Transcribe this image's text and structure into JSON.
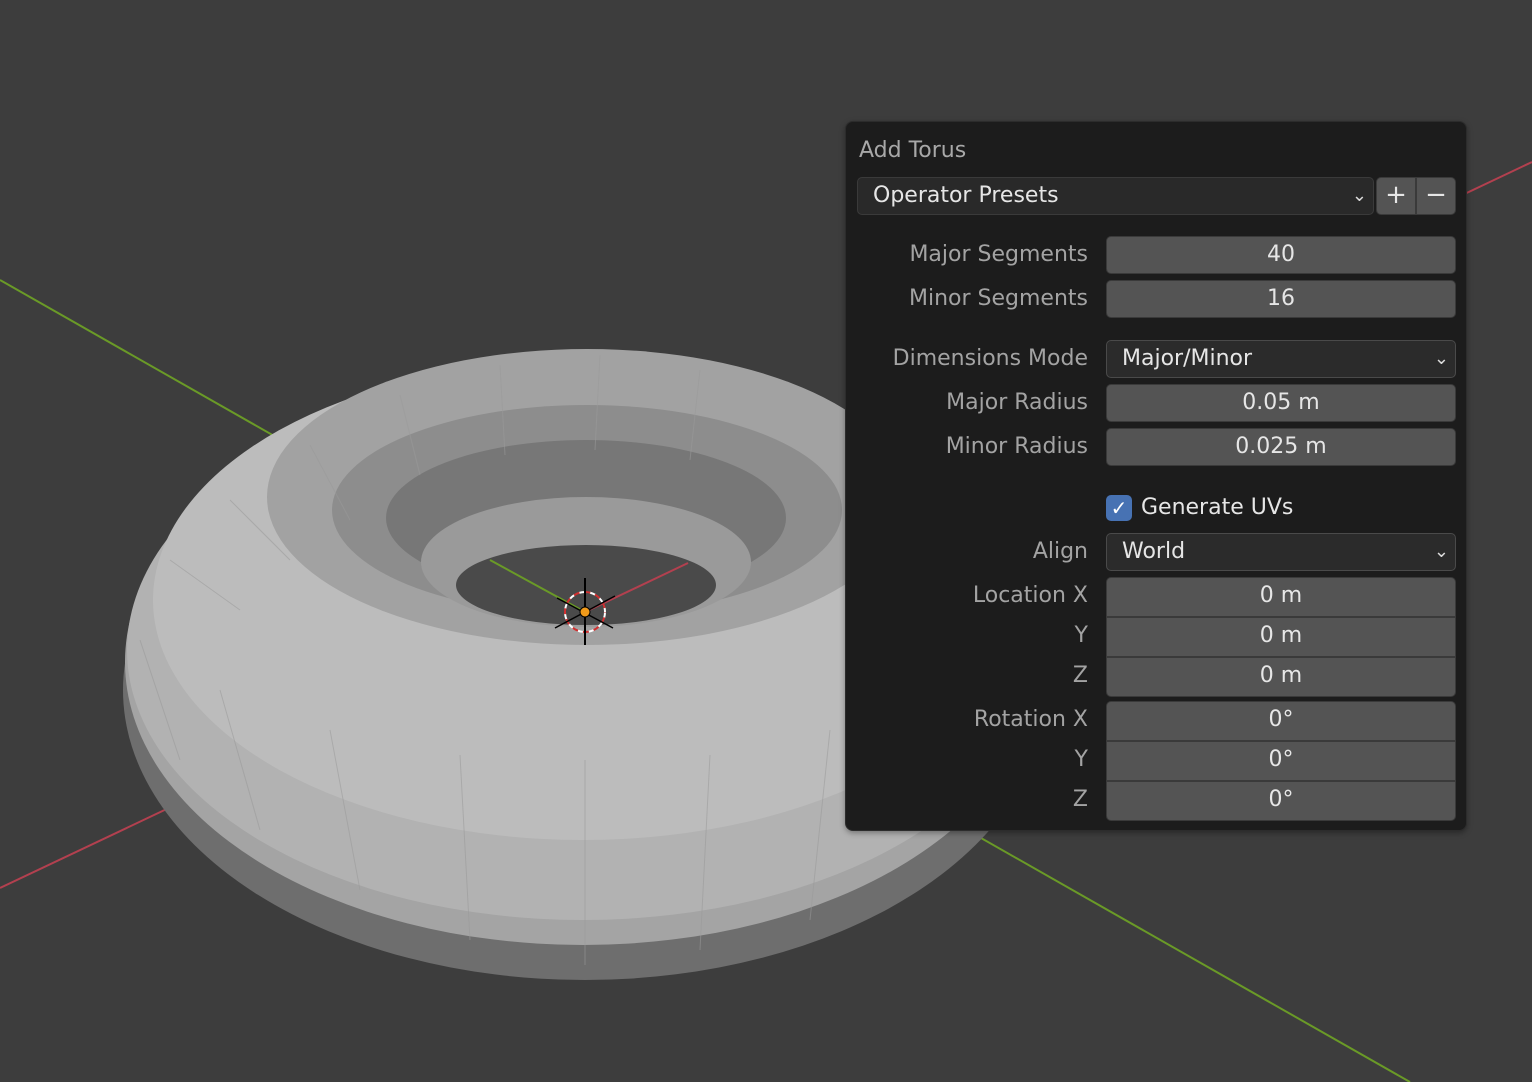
{
  "panel": {
    "title": "Add Torus",
    "presets": {
      "label": "Operator Presets",
      "add_icon": "plus-icon",
      "remove_icon": "minus-icon"
    }
  },
  "fields": {
    "major_segments": {
      "label": "Major Segments",
      "value": "40"
    },
    "minor_segments": {
      "label": "Minor Segments",
      "value": "16"
    },
    "dimensions_mode": {
      "label": "Dimensions Mode",
      "value": "Major/Minor"
    },
    "major_radius": {
      "label": "Major Radius",
      "value": "0.05 m"
    },
    "minor_radius": {
      "label": "Minor Radius",
      "value": "0.025 m"
    },
    "generate_uvs": {
      "label": "Generate UVs",
      "checked": true
    },
    "align": {
      "label": "Align",
      "value": "World"
    },
    "location": {
      "label_x": "Location X",
      "label_y": "Y",
      "label_z": "Z",
      "x": "0 m",
      "y": "0 m",
      "z": "0 m"
    },
    "rotation": {
      "label_x": "Rotation X",
      "label_y": "Y",
      "label_z": "Z",
      "x": "0°",
      "y": "0°",
      "z": "0°"
    }
  },
  "colors": {
    "x_axis": "#b3404f",
    "y_axis": "#6a9a27",
    "checkbox": "#4772b3",
    "background": "#3d3d3d"
  }
}
